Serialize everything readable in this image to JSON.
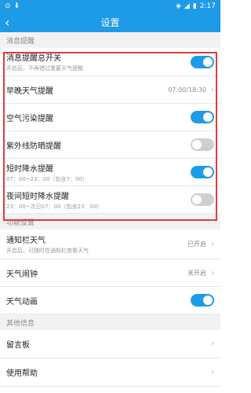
{
  "status": {
    "left_icons": [
      "notification-icon",
      "download-icon"
    ],
    "right_icons": [
      "wifi-icon",
      "signal-icon",
      "battery-icon"
    ],
    "time": "2:17"
  },
  "header": {
    "title": "设置"
  },
  "sections": {
    "notifications": "消息提醒",
    "features": "功能设置",
    "other": "其他信息"
  },
  "notifications": {
    "master": {
      "label": "消息提醒总开关",
      "sub": "开启后，不再错过重要天气提醒",
      "on": true
    },
    "morning_evening": {
      "label": "早晚天气提醒",
      "value": "07:00/18:30"
    },
    "air_pollution": {
      "label": "空气污染提醒",
      "on": true
    },
    "uv": {
      "label": "紫外线防晒提醒",
      "on": false
    },
    "short_rain": {
      "label": "短时降水提醒",
      "sub": "07：00~23：00（包含7：00）",
      "on": true
    },
    "night_rain": {
      "label": "夜间短时降水提醒",
      "sub": "23：00~次日07：00（包含23：00）",
      "on": false
    }
  },
  "features": {
    "notification_bar": {
      "label": "通知栏天气",
      "sub": "开启后，可随时在通知栏查看天气",
      "value": "已开启"
    },
    "alarm": {
      "label": "天气闹钟",
      "value": "未开启"
    },
    "animation": {
      "label": "天气动画",
      "on": true
    }
  },
  "other": {
    "message_board": {
      "label": "留言板"
    },
    "help": {
      "label": "使用帮助"
    }
  },
  "colors": {
    "accent": "#1e9be6",
    "highlight_box": "#e23b3b"
  }
}
